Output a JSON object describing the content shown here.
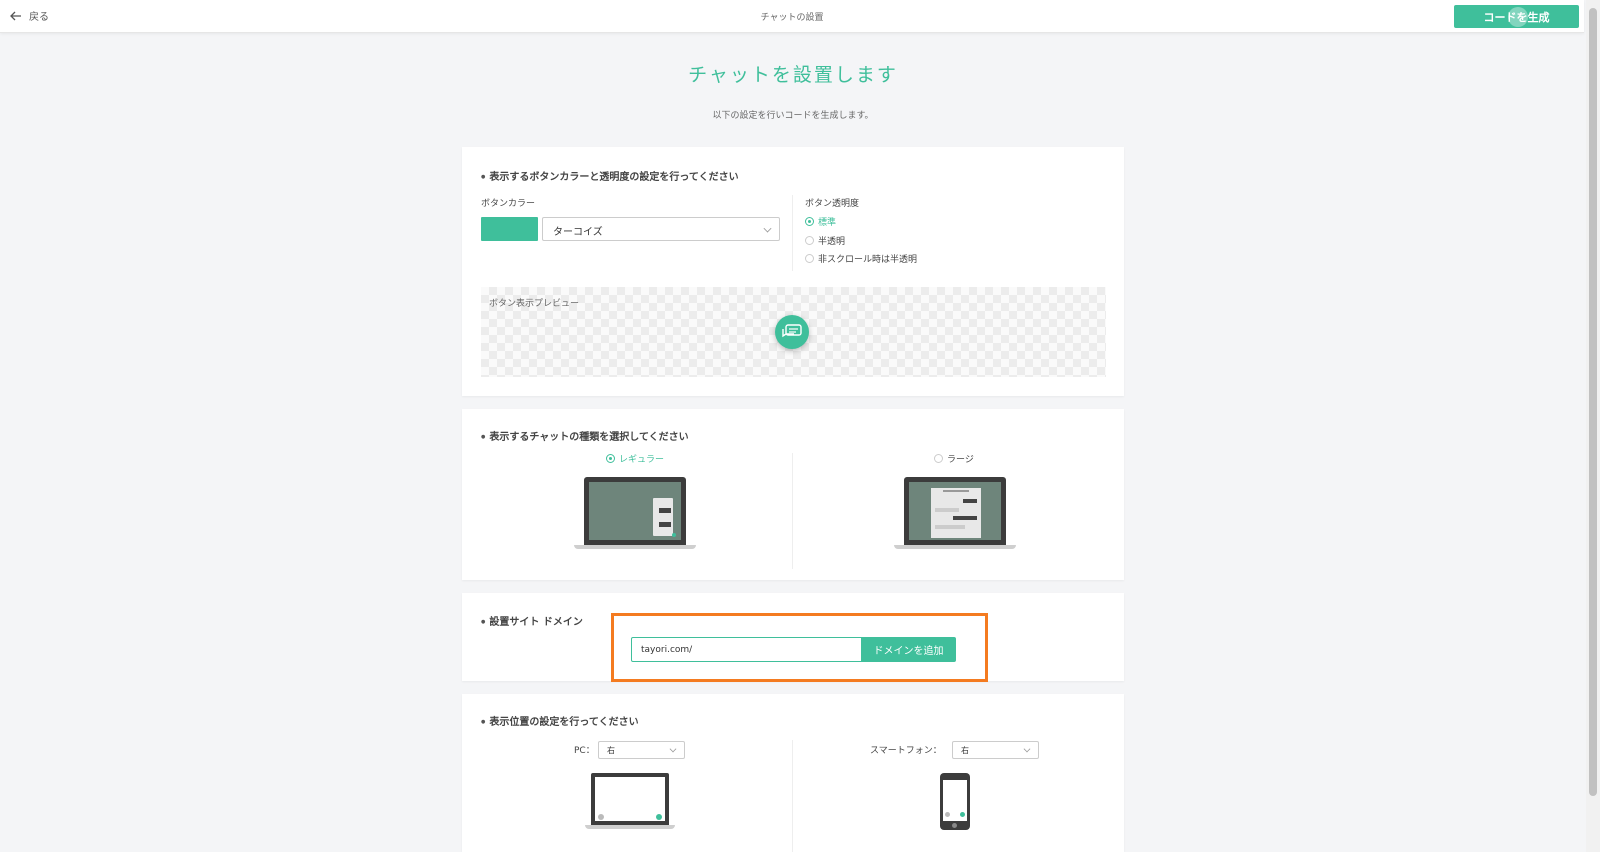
{
  "header": {
    "back_label": "戻る",
    "title": "チャットの設置",
    "generate_label": "コードを生成"
  },
  "page": {
    "heading": "チャットを設置します",
    "subheading": "以下の設定を行いコードを生成します。"
  },
  "color_section": {
    "title": "表示するボタンカラーと透明度の設定を行ってください",
    "color_label": "ボタンカラー",
    "color_value": "ターコイズ",
    "swatch_color": "#3fbf9b",
    "opacity_label": "ボタン透明度",
    "opacity_options": [
      "標準",
      "半透明",
      "非スクロール時は半透明"
    ],
    "opacity_selected": "標準",
    "preview_label": "ボタン表示プレビュー"
  },
  "chat_type_section": {
    "title": "表示するチャットの種類を選択してください",
    "options": [
      "レギュラー",
      "ラージ"
    ],
    "selected": "レギュラー"
  },
  "domain_section": {
    "title": "設置サイト ドメイン",
    "input_value": "tayori.com/",
    "add_label": "ドメインを追加"
  },
  "position_section": {
    "title": "表示位置の設定を行ってください",
    "pc_label": "PC：",
    "pc_value": "右",
    "sp_label": "スマートフォン：",
    "sp_value": "右"
  },
  "colors": {
    "accent": "#3fbf9b",
    "highlight": "#f47b20"
  }
}
